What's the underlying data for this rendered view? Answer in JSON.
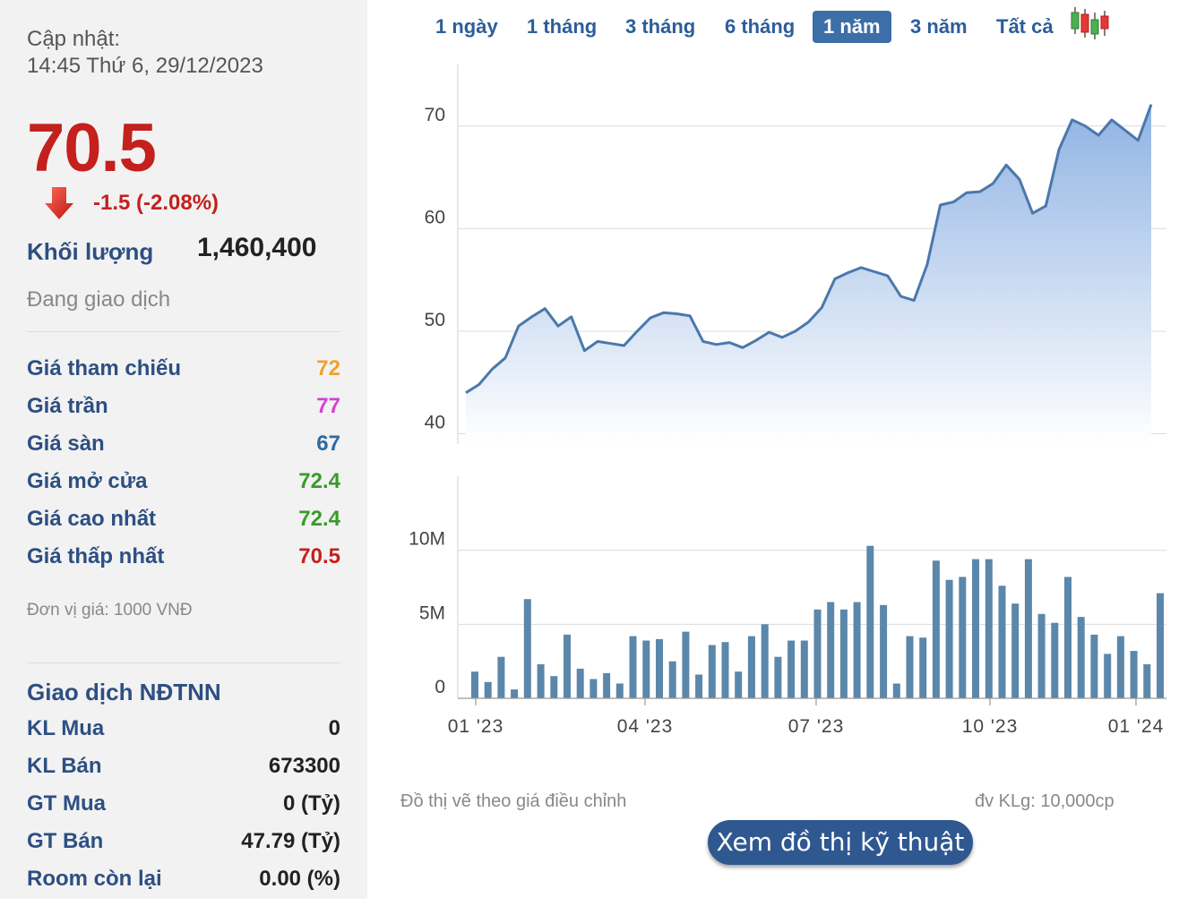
{
  "info": {
    "updated_label": "Cập nhật:",
    "updated_time": "14:45 Thứ 6, 29/12/2023",
    "price": "70.5",
    "change": "-1.5 (-2.08%)",
    "volume_label": "Khối lượng",
    "volume_value": "1,460,400",
    "status": "Đang giao dịch",
    "unit_note": "Đơn vị giá: 1000 VNĐ",
    "colors": {
      "down": "#c4201d",
      "ref": "#f0a030",
      "ceiling": "#d640d6",
      "floor": "#2d6aa0",
      "up": "#3a9a2a"
    }
  },
  "price_rows": [
    {
      "label": "Giá tham chiếu",
      "value": "72",
      "color": "#f0a030"
    },
    {
      "label": "Giá trần",
      "value": "77",
      "color": "#d640d6"
    },
    {
      "label": "Giá sàn",
      "value": "67",
      "color": "#2d6aa0"
    },
    {
      "label": "Giá mở cửa",
      "value": "72.4",
      "color": "#3a9a2a"
    },
    {
      "label": "Giá cao nhất",
      "value": "72.4",
      "color": "#3a9a2a"
    },
    {
      "label": "Giá thấp nhất",
      "value": "70.5",
      "color": "#c4201d"
    }
  ],
  "foreign": {
    "title": "Giao dịch NĐTNN",
    "rows": [
      {
        "label": "KL Mua",
        "value": "0"
      },
      {
        "label": "KL Bán",
        "value": "673300"
      },
      {
        "label": "GT Mua",
        "value": "0 (Tỷ)"
      },
      {
        "label": "GT Bán",
        "value": "47.79 (Tỷ)"
      },
      {
        "label": "Room còn lại",
        "value": "0.00 (%)"
      }
    ]
  },
  "tabs": [
    {
      "label": "1 ngày",
      "active": false
    },
    {
      "label": "1 tháng",
      "active": false
    },
    {
      "label": "3 tháng",
      "active": false
    },
    {
      "label": "6 tháng",
      "active": false
    },
    {
      "label": "1 năm",
      "active": true
    },
    {
      "label": "3 năm",
      "active": false
    },
    {
      "label": "Tất cả",
      "active": false
    }
  ],
  "candlestick_icon": "candlestick-icon",
  "chart_data": [
    {
      "type": "area",
      "x_ticks": [
        "01 '23",
        "04 '23",
        "07 '23",
        "10 '23",
        "01 '24"
      ],
      "yticks": [
        "40",
        "50",
        "60",
        "70"
      ],
      "ylim": [
        39,
        76
      ],
      "values": [
        44,
        44.8,
        46.3,
        47.4,
        50.5,
        51.4,
        52.2,
        50.5,
        51.4,
        48.1,
        49.0,
        48.8,
        48.6,
        50.0,
        51.3,
        51.8,
        51.7,
        51.5,
        49.0,
        48.7,
        48.9,
        48.4,
        49.1,
        49.9,
        49.4,
        50.0,
        50.9,
        52.3,
        55.1,
        55.7,
        56.2,
        55.8,
        55.4,
        53.4,
        53.0,
        56.5,
        62.3,
        62.6,
        63.5,
        63.6,
        64.4,
        66.2,
        64.8,
        61.5,
        62.2,
        67.7,
        70.6,
        70.0,
        69.1,
        70.6,
        69.6,
        68.6,
        72.1
      ],
      "colors": {
        "line": "#4a78ab",
        "fill_top": "#8fb3e3",
        "fill_bottom": "#ffffff"
      }
    },
    {
      "type": "bar",
      "yticks": [
        "0",
        "5M",
        "10M"
      ],
      "ylim": [
        0,
        15
      ],
      "unit": "M",
      "values": [
        1.8,
        1.1,
        2.8,
        0.6,
        6.7,
        2.3,
        1.5,
        4.3,
        2.0,
        1.3,
        1.7,
        1.0,
        4.2,
        3.9,
        4.0,
        2.5,
        4.5,
        1.6,
        3.6,
        3.8,
        1.8,
        4.2,
        5.0,
        2.8,
        3.9,
        3.9,
        6.0,
        6.5,
        6.0,
        6.5,
        10.3,
        6.3,
        1.0,
        4.2,
        4.1,
        9.3,
        8.0,
        8.2,
        9.4,
        9.4,
        7.6,
        6.4,
        9.4,
        5.7,
        5.1,
        8.2,
        5.5,
        4.3,
        3.0,
        4.2,
        3.2,
        2.3,
        7.1
      ],
      "color": "#5b87aa"
    }
  ],
  "footnotes": {
    "left": "Đồ thị vẽ theo giá điều chỉnh",
    "right": "đv KLg: 10,000cp"
  },
  "tech_button": "Xem đồ thị kỹ thuật"
}
